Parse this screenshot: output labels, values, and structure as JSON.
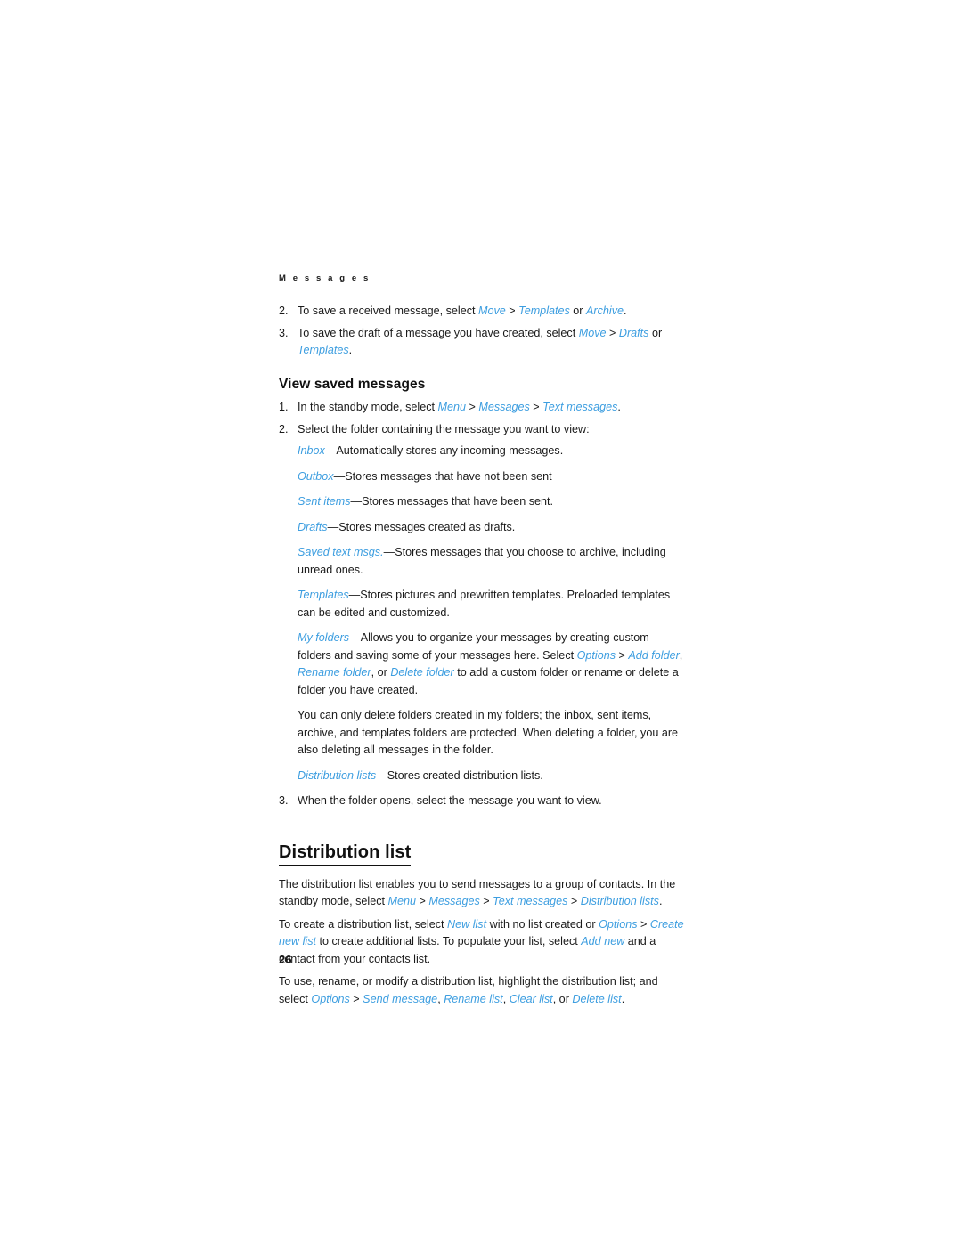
{
  "document": {
    "running_header": "M e s s a g e s",
    "page_number": "26",
    "link_color": "#3d9ee0",
    "text_color": "#1a1a1a"
  },
  "continued_list": {
    "items": [
      {
        "number": "2.",
        "parts": [
          {
            "t": "To save a received message, select ",
            "k": "plain"
          },
          {
            "t": "Move",
            "k": "ui"
          },
          {
            "t": " > ",
            "k": "plain"
          },
          {
            "t": "Templates",
            "k": "ui"
          },
          {
            "t": " or ",
            "k": "plain"
          },
          {
            "t": "Archive",
            "k": "ui"
          },
          {
            "t": ".",
            "k": "plain"
          }
        ]
      },
      {
        "number": "3.",
        "parts": [
          {
            "t": "To save the draft of a message you have created, select ",
            "k": "plain"
          },
          {
            "t": "Move",
            "k": "ui"
          },
          {
            "t": " > ",
            "k": "plain"
          },
          {
            "t": "Drafts",
            "k": "ui"
          },
          {
            "t": " or ",
            "k": "plain"
          },
          {
            "t": "Templates",
            "k": "ui"
          },
          {
            "t": ".",
            "k": "plain"
          }
        ]
      }
    ]
  },
  "view_saved_messages": {
    "heading": "View saved messages",
    "items": [
      {
        "number": "1.",
        "parts": [
          {
            "t": "In the standby mode, select ",
            "k": "plain"
          },
          {
            "t": "Menu",
            "k": "ui"
          },
          {
            "t": " > ",
            "k": "plain"
          },
          {
            "t": "Messages",
            "k": "ui"
          },
          {
            "t": " > ",
            "k": "plain"
          },
          {
            "t": "Text messages",
            "k": "ui"
          },
          {
            "t": ".",
            "k": "plain"
          }
        ]
      },
      {
        "number": "2.",
        "parts": [
          {
            "t": "Select the folder containing the message you want to view:",
            "k": "plain"
          }
        ]
      }
    ],
    "folders": [
      {
        "parts": [
          {
            "t": "Inbox",
            "k": "ui"
          },
          {
            "t": "—Automatically stores any incoming messages.",
            "k": "plain"
          }
        ]
      },
      {
        "parts": [
          {
            "t": "Outbox",
            "k": "ui"
          },
          {
            "t": "—Stores messages that have not been sent",
            "k": "plain"
          }
        ]
      },
      {
        "parts": [
          {
            "t": "Sent items",
            "k": "ui"
          },
          {
            "t": "—Stores messages that have been sent.",
            "k": "plain"
          }
        ]
      },
      {
        "parts": [
          {
            "t": "Drafts",
            "k": "ui"
          },
          {
            "t": "—Stores messages created as drafts.",
            "k": "plain"
          }
        ]
      },
      {
        "parts": [
          {
            "t": "Saved text msgs.",
            "k": "ui"
          },
          {
            "t": "—Stores messages that you choose to archive, including unread ones.",
            "k": "plain"
          }
        ]
      },
      {
        "parts": [
          {
            "t": "Templates",
            "k": "ui"
          },
          {
            "t": "—Stores pictures and prewritten templates. Preloaded templates can be edited and customized.",
            "k": "plain"
          }
        ]
      },
      {
        "parts": [
          {
            "t": "My folders",
            "k": "ui"
          },
          {
            "t": "—Allows you to organize your messages by creating custom folders and saving some of your messages here. Select ",
            "k": "plain"
          },
          {
            "t": "Options",
            "k": "ui"
          },
          {
            "t": " > ",
            "k": "plain"
          },
          {
            "t": "Add folder",
            "k": "ui"
          },
          {
            "t": ", ",
            "k": "plain"
          },
          {
            "t": "Rename folder",
            "k": "ui"
          },
          {
            "t": ", or ",
            "k": "plain"
          },
          {
            "t": "Delete folder",
            "k": "ui"
          },
          {
            "t": " to add a custom folder or rename or delete a folder you have created.",
            "k": "plain"
          }
        ]
      },
      {
        "parts": [
          {
            "t": "You can only delete folders created in my folders; the inbox, sent items, archive, and templates folders are protected. When deleting a folder, you are also deleting all messages in the folder.",
            "k": "plain"
          }
        ]
      },
      {
        "parts": [
          {
            "t": "Distribution lists",
            "k": "ui"
          },
          {
            "t": "—Stores created distribution lists.",
            "k": "plain"
          }
        ]
      }
    ],
    "final_item": {
      "number": "3.",
      "parts": [
        {
          "t": "When the folder opens, select the message you want to view.",
          "k": "plain"
        }
      ]
    }
  },
  "distribution_list": {
    "heading": "Distribution list",
    "paragraphs": [
      {
        "parts": [
          {
            "t": "The distribution list enables you to send messages to a group of contacts. In the standby mode, select ",
            "k": "plain"
          },
          {
            "t": "Menu",
            "k": "ui"
          },
          {
            "t": " > ",
            "k": "plain"
          },
          {
            "t": "Messages",
            "k": "ui"
          },
          {
            "t": " > ",
            "k": "plain"
          },
          {
            "t": "Text messages",
            "k": "ui"
          },
          {
            "t": " > ",
            "k": "plain"
          },
          {
            "t": "Distribution lists",
            "k": "ui"
          },
          {
            "t": ".",
            "k": "plain"
          }
        ]
      },
      {
        "parts": [
          {
            "t": "To create a distribution list, select ",
            "k": "plain"
          },
          {
            "t": "New list",
            "k": "ui"
          },
          {
            "t": " with no list created or ",
            "k": "plain"
          },
          {
            "t": "Options",
            "k": "ui"
          },
          {
            "t": " > ",
            "k": "plain"
          },
          {
            "t": "Create new list",
            "k": "ui"
          },
          {
            "t": " to create additional lists. To populate your list, select ",
            "k": "plain"
          },
          {
            "t": "Add new",
            "k": "ui"
          },
          {
            "t": " and a contact from your contacts list.",
            "k": "plain"
          }
        ]
      },
      {
        "parts": [
          {
            "t": "To use, rename, or modify a distribution list, highlight the distribution list; and select ",
            "k": "plain"
          },
          {
            "t": "Options",
            "k": "ui"
          },
          {
            "t": " > ",
            "k": "plain"
          },
          {
            "t": "Send message",
            "k": "ui"
          },
          {
            "t": ", ",
            "k": "plain"
          },
          {
            "t": "Rename list",
            "k": "ui"
          },
          {
            "t": ", ",
            "k": "plain"
          },
          {
            "t": "Clear list",
            "k": "ui"
          },
          {
            "t": ", or ",
            "k": "plain"
          },
          {
            "t": "Delete list",
            "k": "ui"
          },
          {
            "t": ".",
            "k": "plain"
          }
        ]
      }
    ]
  }
}
